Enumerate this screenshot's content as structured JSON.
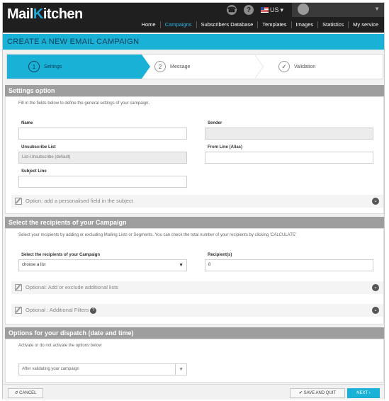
{
  "app": {
    "logo_a": "Mail",
    "logo_k": "K",
    "logo_b": "itchen",
    "language": "US"
  },
  "nav": {
    "items": [
      "Home",
      "Campaigns",
      "Subscribers Database",
      "Templates",
      "Images",
      "Statistics",
      "My service"
    ],
    "active": "Campaigns"
  },
  "page": {
    "title": "CREATE A NEW EMAIL CAMPAIGN"
  },
  "steps": [
    {
      "num": "1",
      "label": "Settings"
    },
    {
      "num": "2",
      "label": "Message"
    },
    {
      "num": "",
      "label": "Validation"
    }
  ],
  "settings": {
    "heading": "Settings option",
    "description": "Fill in the fields below to define the general settings of your campaign.",
    "name_label": "Name",
    "sender_label": "Sender",
    "unsubscribe_label": "Unsubscribe List",
    "unsubscribe_value": "List-Unsubscribe (default)",
    "from_line_label": "From Line (Alias)",
    "subject_label": "Subject Line",
    "option_personalised": "Option: add a personalised field in the subject"
  },
  "recipients": {
    "heading": "Select the recipients of your Campaign",
    "description": "Select your recipients by adding or excluding Mailing Lists or Segments. You can check the total number of your recipients by clicking 'CALCULATE'",
    "select_label": "Select the recipients of your Campaign",
    "select_value": "choose a list",
    "count_label": "Recipient(s)",
    "count_value": "0",
    "option_lists": "Optional: Add or exclude additional lists",
    "option_filters": "Optional : Additional Filters"
  },
  "dispatch": {
    "heading": "Options for your dispatch (date and time)",
    "description": "Activate or do not activate the options below",
    "select_value": "After validating your campaign"
  },
  "footer": {
    "cancel": "CANCEL",
    "save": "SAVE AND QUIT",
    "next": "NEXT"
  },
  "colors": {
    "accent": "#19b1d6",
    "topbar": "#1f1f1f",
    "section_header": "#9e9e9e"
  }
}
